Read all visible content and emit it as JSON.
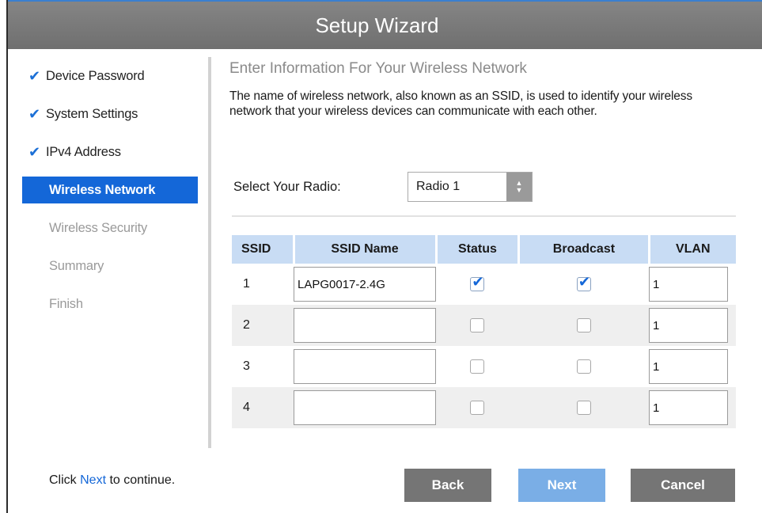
{
  "window": {
    "title": "Setup Wizard"
  },
  "sidebar": {
    "steps": [
      {
        "label": "Device Password",
        "state": "done"
      },
      {
        "label": "System Settings",
        "state": "done"
      },
      {
        "label": "IPv4 Address",
        "state": "done"
      },
      {
        "label": "Wireless Network",
        "state": "current"
      },
      {
        "label": "Wireless Security",
        "state": "pending"
      },
      {
        "label": "Summary",
        "state": "pending"
      },
      {
        "label": "Finish",
        "state": "pending"
      }
    ],
    "check_glyph": "✔"
  },
  "main": {
    "heading": "Enter Information For Your Wireless Network",
    "description": "The name of wireless network, also known as an SSID, is used to identify your wireless network that your wireless devices can communicate with each other.",
    "radio": {
      "label": "Select Your Radio:",
      "value": "Radio 1"
    },
    "table": {
      "headers": [
        "SSID",
        "SSID Name",
        "Status",
        "Broadcast",
        "VLAN"
      ],
      "rows": [
        {
          "ssid": "1",
          "name": "LAPG0017-2.4G",
          "status": true,
          "broadcast": true,
          "vlan": "1"
        },
        {
          "ssid": "2",
          "name": "",
          "status": false,
          "broadcast": false,
          "vlan": "1"
        },
        {
          "ssid": "3",
          "name": "",
          "status": false,
          "broadcast": false,
          "vlan": "1"
        },
        {
          "ssid": "4",
          "name": "",
          "status": false,
          "broadcast": false,
          "vlan": "1"
        }
      ]
    }
  },
  "footer": {
    "hint_prefix": "Click ",
    "hint_link": "Next",
    "hint_suffix": " to continue.",
    "buttons": {
      "back": "Back",
      "next": "Next",
      "cancel": "Cancel"
    }
  },
  "colors": {
    "accent": "#1467d8",
    "titlebar": "#7a7a7a",
    "header_row": "#c8dcf4",
    "next_button": "#7aaee6",
    "gray_button": "#757575"
  }
}
